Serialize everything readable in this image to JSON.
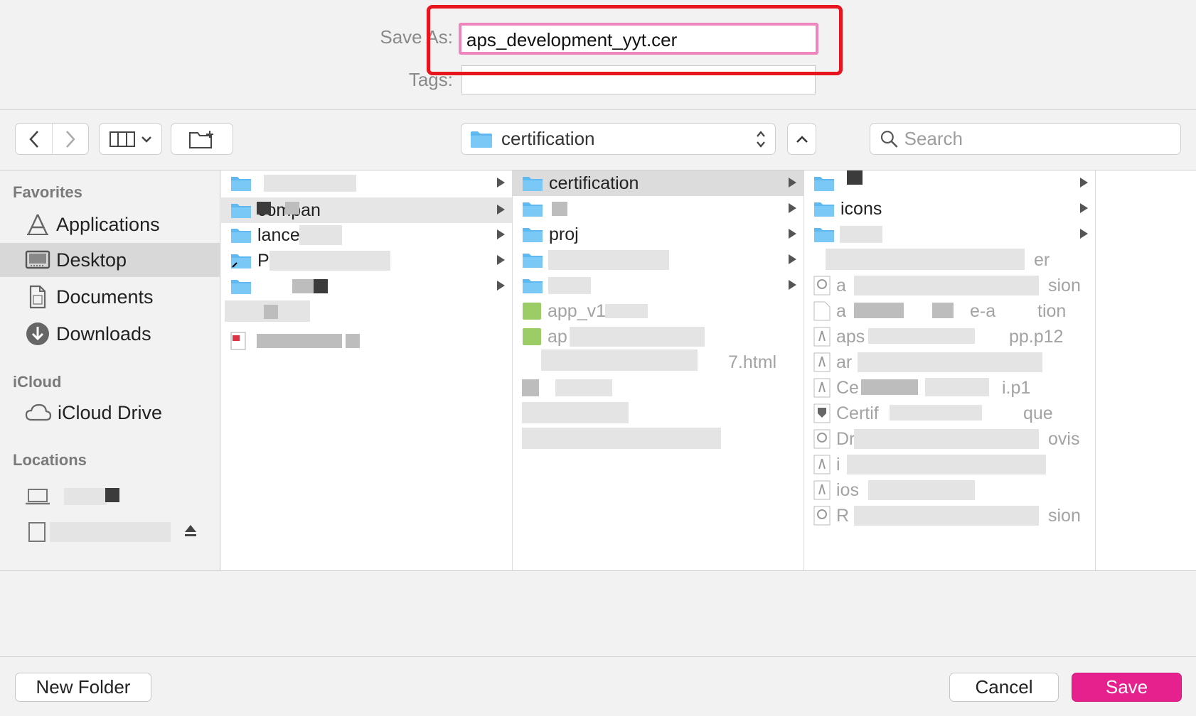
{
  "header": {
    "save_as_label": "Save As:",
    "file_name": "aps_development_yyt.cer",
    "tags_label": "Tags:"
  },
  "toolbar": {
    "location": "certification",
    "search_placeholder": "Search"
  },
  "sidebar": {
    "favorites_heading": "Favorites",
    "favorites": [
      {
        "label": "Applications",
        "icon": "applications-icon"
      },
      {
        "label": "Desktop",
        "icon": "desktop-icon",
        "selected": true
      },
      {
        "label": "Documents",
        "icon": "documents-icon"
      },
      {
        "label": "Downloads",
        "icon": "downloads-icon"
      }
    ],
    "icloud_heading": "iCloud",
    "icloud": [
      {
        "label": "iCloud Drive",
        "icon": "cloud-icon"
      }
    ],
    "locations_heading": "Locations"
  },
  "columns": {
    "col1": [
      "compan",
      "lance",
      "P"
    ],
    "col2": [
      "certification",
      "proj",
      "app_v1",
      "ap",
      "7.html"
    ],
    "col3": [
      "icons",
      "er",
      "a",
      "sion",
      "a",
      "e-a",
      "tion",
      "aps",
      "pp.p12",
      "ar",
      "Ce",
      "i.p1",
      "Certif",
      "que",
      "Dr",
      "ovis",
      "i",
      "ios",
      "R",
      "sion"
    ]
  },
  "footer": {
    "new_folder": "New Folder",
    "cancel": "Cancel",
    "save": "Save"
  },
  "colors": {
    "accent": "#e6208c",
    "field_focus": "#ee86bd",
    "annotation": "#e8141e",
    "folder": "#5fb8ef"
  }
}
